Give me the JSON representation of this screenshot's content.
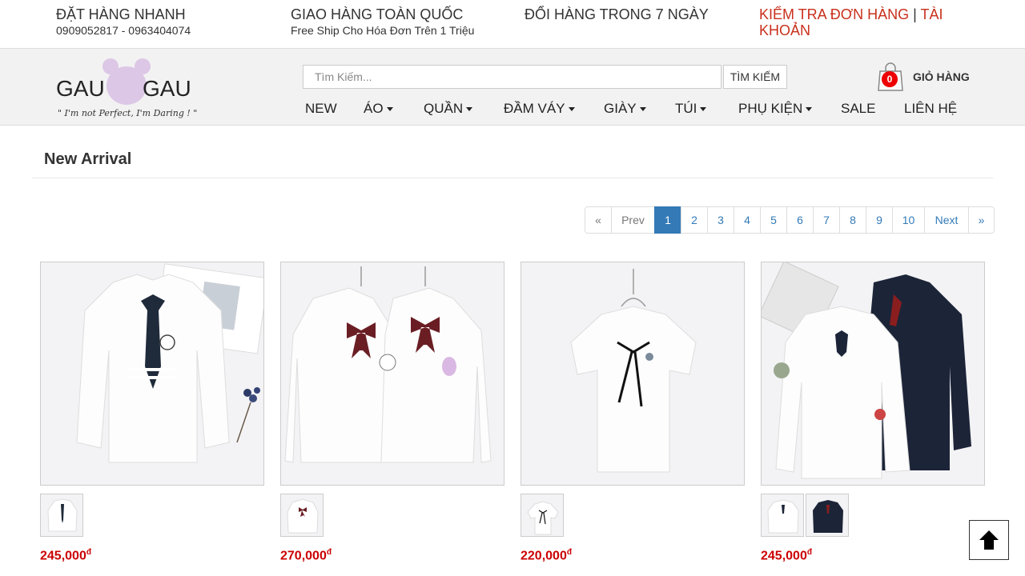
{
  "topbar": {
    "quick_order_title": "ĐẶT HÀNG NHANH",
    "quick_order_phones": "0909052817 - 0963404074",
    "shipping_title": "GIAO HÀNG TOÀN QUỐC",
    "shipping_sub": "Free Ship Cho Hóa Đơn Trên 1 Triệu",
    "exchange_title": "ĐỔI HÀNG TRONG 7 NGÀY",
    "order_check_link": "KIỂM TRA ĐƠN HÀNG",
    "separator": "|",
    "account_link": "TÀI KHOẢN"
  },
  "logo": {
    "left_text": "GAU",
    "right_text": "GAU",
    "tagline": "\" I'm not Perfect, I'm Daring ! \""
  },
  "search": {
    "placeholder": "Tìm Kiếm...",
    "button_label": "TÌM KIẾM"
  },
  "cart": {
    "count": "0",
    "label": "GIỎ HÀNG"
  },
  "nav": {
    "items": [
      {
        "label": "NEW",
        "dropdown": false
      },
      {
        "label": "ÁO",
        "dropdown": true
      },
      {
        "label": "QUẦN",
        "dropdown": true
      },
      {
        "label": "ĐẦM VÁY",
        "dropdown": true
      },
      {
        "label": "GIÀY",
        "dropdown": true
      },
      {
        "label": "TÚI",
        "dropdown": true
      },
      {
        "label": "PHỤ KIỆN",
        "dropdown": true
      },
      {
        "label": "SALE",
        "dropdown": false
      },
      {
        "label": "LIÊN HỆ",
        "dropdown": false
      }
    ]
  },
  "section": {
    "title": "New Arrival"
  },
  "pagination": {
    "first": "«",
    "prev": "Prev",
    "pages": [
      "1",
      "2",
      "3",
      "4",
      "5",
      "6",
      "7",
      "8",
      "9",
      "10"
    ],
    "active_page": "1",
    "next": "Next",
    "last": "»"
  },
  "products": [
    {
      "price": "245,000",
      "currency": "đ",
      "thumbnails": 1
    },
    {
      "price": "270,000",
      "currency": "đ",
      "thumbnails": 1
    },
    {
      "price": "220,000",
      "currency": "đ",
      "thumbnails": 1
    },
    {
      "price": "245,000",
      "currency": "đ",
      "thumbnails": 2
    }
  ],
  "icons": {
    "cart": "shopping-bag-icon",
    "back_to_top": "arrow-up-icon",
    "logo_mark": "bear-ears-icon"
  },
  "colors": {
    "accent_red": "#c9301c",
    "price_red": "#cc0000",
    "pagination_blue": "#337ab7",
    "header_bg": "#f2f2f2"
  }
}
